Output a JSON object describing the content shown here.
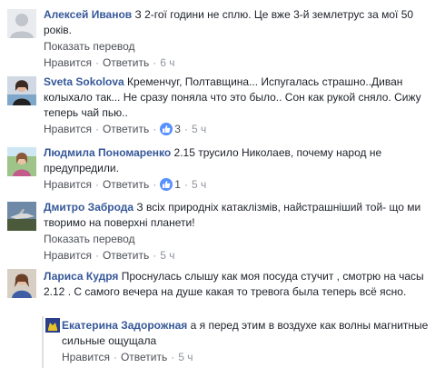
{
  "comments": [
    {
      "author": "Алексей Иванов",
      "text": " З 2-гої години не сплю. Це вже 3-й землетрус за мої 50 років.",
      "translate": "Показать перевод",
      "like": "Нравится",
      "reply": "Ответить",
      "likes": "",
      "time": "6 ч"
    },
    {
      "author": "Sveta Sokolova",
      "text": " Кременчуг, Полтавщина... Испугалась страшно..Диван колыхало так... Не сразу поняла что это было.. Сон как рукой сняло. Сижу теперь чай пью..",
      "translate": "",
      "like": "Нравится",
      "reply": "Ответить",
      "likes": "3",
      "time": "5 ч"
    },
    {
      "author": "Людмила Пономаренко",
      "text": " 2.15 трусило Николаев, почему народ не предупредили.",
      "translate": "",
      "like": "Нравится",
      "reply": "Ответить",
      "likes": "1",
      "time": "5 ч"
    },
    {
      "author": "Дмитро Заброда",
      "text": " З всіх природніх катаклізмів, найстрашніший той- що ми творимо на поверхні планети!",
      "translate": "Показать перевод",
      "like": "Нравится",
      "reply": "Ответить",
      "likes": "",
      "time": "5 ч"
    },
    {
      "author": "Лариса Кудря",
      "text": " Проснулась слышу как моя посуда стучит , смотрю на часы 2.12 . С самого вечера на душе какая то тревога была теперь всё ясно.",
      "translate": "",
      "like": "Нравится",
      "reply": "Ответить",
      "likes": "",
      "time": "5 ч"
    },
    {
      "author": "Екатерина Задорожная",
      "text": " а я перед этим в воздухе как волны магнитные сильные ощущала",
      "translate": "",
      "like": "Нравится",
      "reply": "Ответить",
      "likes": "",
      "time": "5 ч"
    }
  ],
  "separator": "·",
  "colors": {
    "author_link": "#365899",
    "meta": "#90949c",
    "action": "#4b4f56",
    "like_badge": "#5890ff",
    "text": "#1d2129"
  },
  "icons": {
    "like_badge": "thumbs-up-icon"
  }
}
